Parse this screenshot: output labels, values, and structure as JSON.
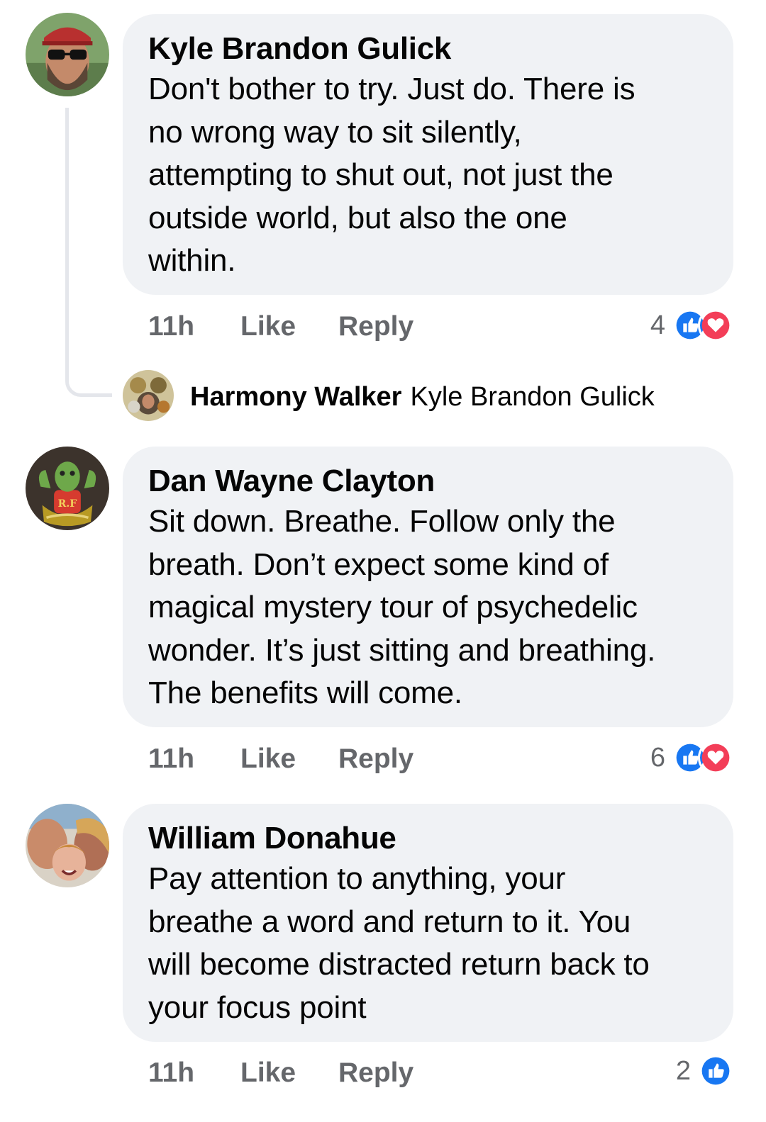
{
  "comments": [
    {
      "author": "Kyle Brandon Gulick",
      "lines": [
        "Don't bother to try. Just do. There is",
        "no wrong way to sit silently,",
        "attempting to shut out, not just the",
        "outside world, but also the one",
        "within."
      ],
      "time": "11h",
      "like_label": "Like",
      "reply_label": "Reply",
      "reaction_count": "4",
      "reactions": [
        "like-icon",
        "love-icon"
      ],
      "reply_preview": {
        "author": "Harmony Walker",
        "mention": "Kyle Brandon Gulick"
      }
    },
    {
      "author": "Dan Wayne Clayton",
      "lines": [
        "Sit down. Breathe. Follow only the",
        "breath. Don’t expect some kind of",
        "magical mystery tour of psychedelic",
        "wonder. It’s just sitting and breathing.",
        "The benefits will come."
      ],
      "time": "11h",
      "like_label": "Like",
      "reply_label": "Reply",
      "reaction_count": "6",
      "reactions": [
        "like-icon",
        "love-icon"
      ]
    },
    {
      "author": "William Donahue",
      "lines": [
        "Pay attention to anything, your",
        "breathe a word and return to it. You",
        "will become distracted return back to",
        "your focus point"
      ],
      "time": "11h",
      "like_label": "Like",
      "reply_label": "Reply",
      "reaction_count": "2",
      "reactions": [
        "like-icon"
      ]
    }
  ],
  "colors": {
    "bubble": "#f0f2f5",
    "meta_text": "#65676b",
    "like_blue": "#1877f2",
    "love_red": "#f33e58",
    "thread_line": "#e4e6eb"
  }
}
